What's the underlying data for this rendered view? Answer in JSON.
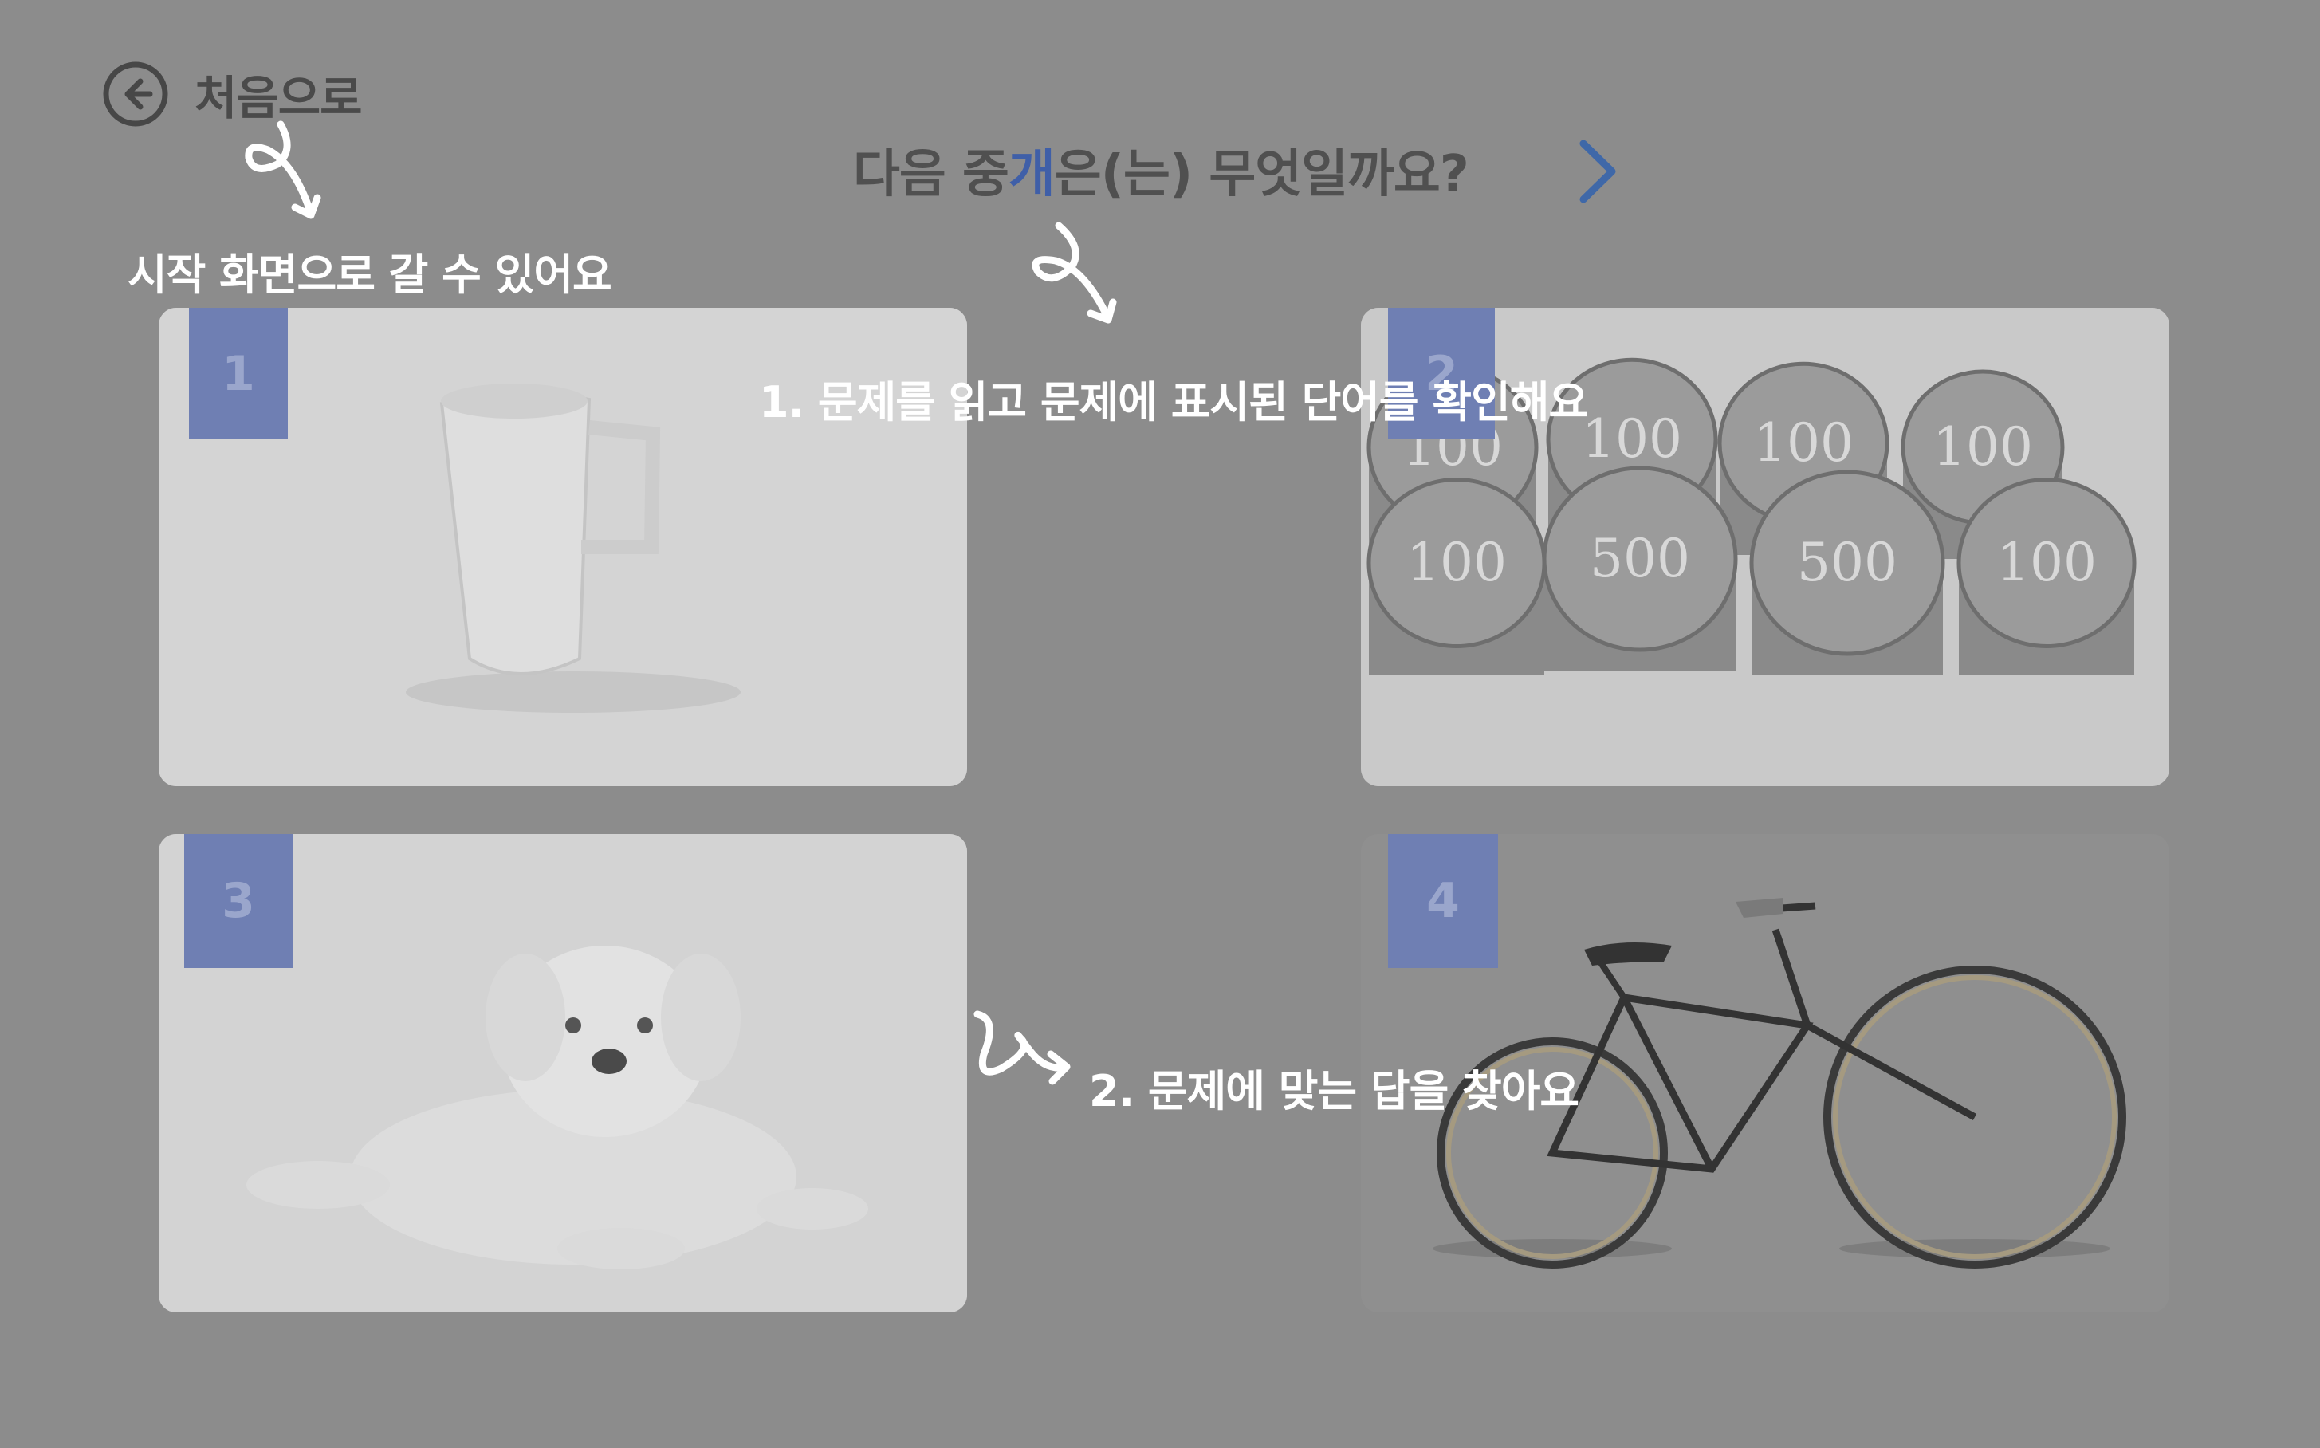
{
  "home": {
    "label": "처음으로",
    "icon": "arrow-left-circle-icon"
  },
  "question": {
    "prefix": "다음 중 ",
    "target_word": "개",
    "suffix": "은(는) 무엇일까요?"
  },
  "next_icon": "chevron-right-icon",
  "options": [
    {
      "number": "1",
      "image": "white-mug"
    },
    {
      "number": "2",
      "image": "stacked-korean-coins"
    },
    {
      "number": "3",
      "image": "white-puppy"
    },
    {
      "number": "4",
      "image": "vintage-bicycle"
    }
  ],
  "coin_labels": [
    "100",
    "100",
    "100",
    "100",
    "100",
    "500",
    "500",
    "100"
  ],
  "tips": {
    "home": "시작 화면으로 갈 수 있어요",
    "step1": "1. 문제를 읽고 문제에 표시된 단어를 확인해요",
    "step2": "2. 문제에 맞는 답을 찾아요"
  },
  "colors": {
    "overlay": "#8c8c8c",
    "highlight": "#3f5fa8",
    "number_badge": "#6f7fb3",
    "tip_text": "#ffffff"
  }
}
